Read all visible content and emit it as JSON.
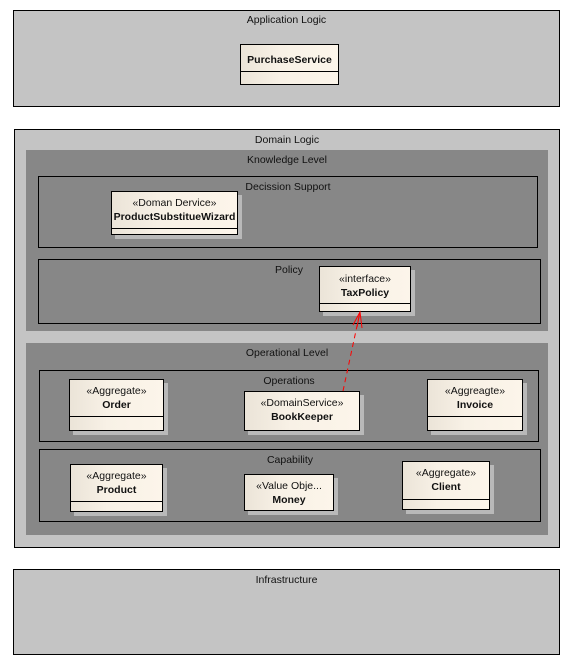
{
  "packages": {
    "application_logic": {
      "title": "Application Logic",
      "classes": {
        "purchase_service": {
          "stereotype": "",
          "name": "PurchaseService"
        }
      }
    },
    "domain_logic": {
      "title": "Domain Logic",
      "knowledge_level": {
        "title": "Knowledge Level",
        "decision_support": {
          "title": "Decission Support",
          "classes": {
            "product_substitue_wizard": {
              "stereotype": "«Doman Dervice»",
              "name": "ProductSubstitueWizard"
            }
          }
        },
        "policy": {
          "title": "Policy",
          "classes": {
            "tax_policy": {
              "stereotype": "«interface»",
              "name": "TaxPolicy"
            }
          }
        }
      },
      "operational_level": {
        "title": "Operational Level",
        "operations": {
          "title": "Operations",
          "classes": {
            "order": {
              "stereotype": "«Aggregate»",
              "name": "Order"
            },
            "book_keeper": {
              "stereotype": "«DomainService»",
              "name": "BookKeeper"
            },
            "invoice": {
              "stereotype": "«Aggreagte»",
              "name": "Invoice"
            }
          }
        },
        "capability": {
          "title": "Capability",
          "classes": {
            "product": {
              "stereotype": "«Aggregate»",
              "name": "Product"
            },
            "money": {
              "stereotype": "«Value Obje...",
              "name": "Money"
            },
            "client": {
              "stereotype": "«Aggregate»",
              "name": "Client"
            }
          }
        }
      }
    },
    "infrastructure": {
      "title": "Infrastructure"
    }
  },
  "relationships": [
    {
      "type": "realization-dependency",
      "from": "BookKeeper",
      "to": "TaxPolicy",
      "style": "dashed",
      "color": "#ff0000"
    }
  ],
  "colors": {
    "package_light": "#c4c4c4",
    "package_dark": "#878787",
    "class_fill": "#fcf5ea",
    "arrow": "#ff0000"
  }
}
